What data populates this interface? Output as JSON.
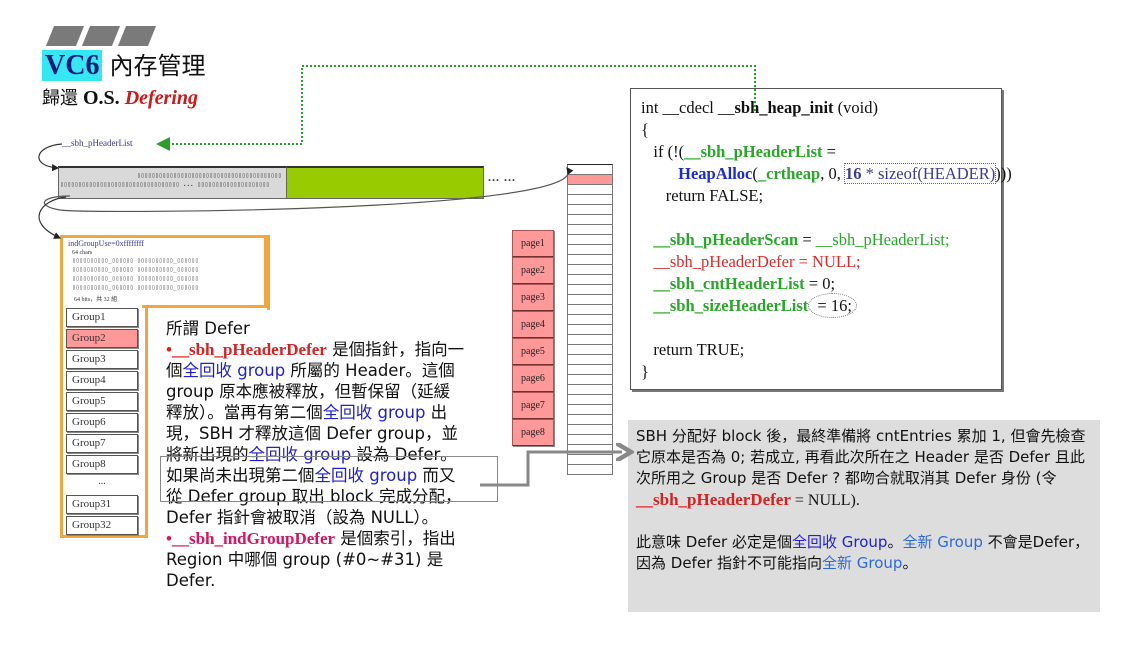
{
  "title": {
    "tag": "VC6",
    "text": "內存管理",
    "subtitle_cn": "歸還",
    "subtitle_os": "O.S.",
    "subtitle_em": "Defering"
  },
  "diagram": {
    "header_list_label": "__sbh_pHeaderList",
    "ellipsis": "... ...",
    "bits_mid_ellipsis": "...",
    "ind_group_use": "indGroupUse=0xffffffff",
    "chars_label": "64 chars",
    "bits_label": "64 bits，共 32 組",
    "groups": [
      "Group1",
      "Group2",
      "Group3",
      "Group4",
      "Group5",
      "Group6",
      "Group7",
      "Group8"
    ],
    "groups_ellipsis": "...",
    "groups_tail": [
      "Group31",
      "Group32"
    ],
    "highlighted_group": "Group2",
    "pages": [
      "page1",
      "page2",
      "page3",
      "page4",
      "page5",
      "page6",
      "page7",
      "page8"
    ]
  },
  "defer_text": {
    "heading": "所謂 Defer",
    "bullet1_var": "•__sbh_pHeaderDefer",
    "bullet1_a": " 是個指針，指向一個",
    "full_recycle": "全回收 group",
    "bullet1_b": " 所屬的 Header。這個 group 原本應被釋放，但暫保留（延緩釋放）。當再有第二個",
    "bullet1_c": " 出現，SBH 才釋放這個 Defer group，並將新出現的",
    "bullet1_d": " 設為 Defer。如果尚未出現第二個",
    "bullet1_e": " 而又從 Defer group 取出 block 完成分配，Defer 指針會被取消（設為 NULL）。",
    "bullet2_var": "•__sbh_indGroupDefer",
    "bullet2_a": " 是個索引，指出 Region 中哪個 group (#0~#31) 是 Defer."
  },
  "code": {
    "l1_a": "int __cdecl __",
    "l1_b": "sbh_heap_init",
    "l1_c": " (void)",
    "l2": "{",
    "l3_a": "   if (!(",
    "l3_b": "__sbh_pHeaderList",
    "l3_c": " =",
    "l4_indent": "         ",
    "l4_a": "HeapAlloc",
    "l4_b": "(",
    "l4_c": "_crtheap",
    "l4_d": ", 0, ",
    "l4_e": "16",
    "l4_f": " * sizeof(HEADER)",
    "l4_g": ")))",
    "l5": "      return FALSE;",
    "l7_a": "   ",
    "l7_b": "__sbh_pHeaderScan",
    "l7_c": " = ",
    "l7_d": "__sbh_pHeaderList;",
    "l8_a": "   ",
    "l8_b": "__sbh_pHeaderDefer = NULL;",
    "l9_a": "   ",
    "l9_b": "__sbh_cntHeaderList",
    "l9_c": " = 0;",
    "l10_a": "   ",
    "l10_b": "__sbh_sizeHeaderList",
    "l10_c": " = 16;",
    "l12": "   return TRUE;",
    "l13": "}"
  },
  "callout": {
    "p1_a": "SBH 分配好 block 後，最終準備將 cntEntries 累加 1, 但會先檢查它原本是否為 0; 若成立, 再看此次所在之 Header 是否 Defer 且此次所用之 Group 是否 Defer ? 都吻合就取消其 Defer 身份 (令 ",
    "p1_var": "__sbh_pHeaderDefer",
    "p1_b": " = NULL).",
    "p2_a": "此意味 Defer 必定是個",
    "p2_full": "全回收 Group",
    "p2_b": "。",
    "p2_new1": "全新 Group",
    "p2_c": " 不會是Defer，因為 Defer 指針不可能指向",
    "p2_new2": "全新 Group",
    "p2_d": "。"
  },
  "colors": {
    "title_tag_bg": "#33e8f2",
    "green_block": "#99cc00",
    "highlight_pink": "#ff9999",
    "region_border": "#f2a73a",
    "code_green": "#28a828",
    "code_red": "#e02828",
    "code_blue": "#1a2ad0",
    "callout_bg": "#dddddd"
  }
}
